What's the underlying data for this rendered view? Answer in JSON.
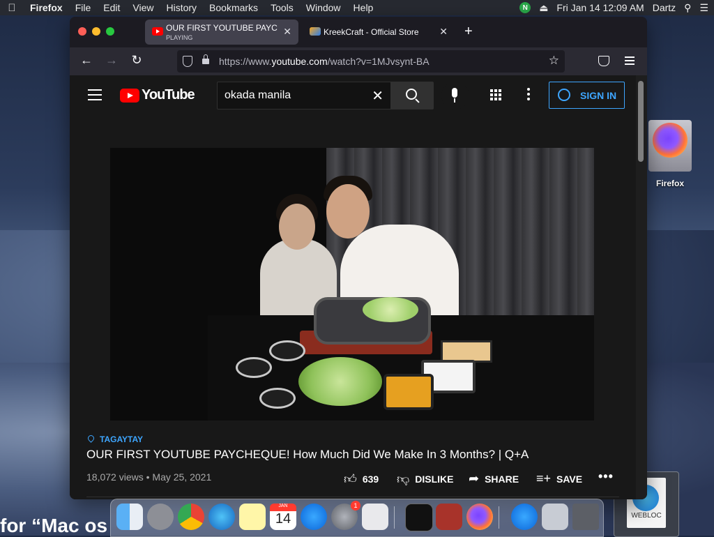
{
  "menubar": {
    "apple": "",
    "items": [
      "Firefox",
      "File",
      "Edit",
      "View",
      "History",
      "Bookmarks",
      "Tools",
      "Window",
      "Help"
    ],
    "clock": "Fri Jan 14  12:09 AM",
    "user": "Dartz",
    "n_badge": "N"
  },
  "browser": {
    "tabs": [
      {
        "title": "OUR FIRST YOUTUBE PAYCHEQUE! How Much Did We Make",
        "subtitle": "PLAYING",
        "active": true
      },
      {
        "title": "KreekCraft - Official Store",
        "subtitle": "",
        "active": false
      }
    ],
    "url_prefix": "https://www.",
    "url_domain": "youtube.com",
    "url_path": "/watch?v=1MJvsynt-BA"
  },
  "youtube": {
    "logo_text": "YouTube",
    "search_query": "okada manila",
    "sign_in_label": "SIGN IN",
    "location_tag": "TAGAYTAY",
    "video_title": "OUR FIRST YOUTUBE PAYCHEQUE! How Much Did We Make In 3 Months? | Q+A",
    "views": "18,072 views",
    "date": "May 25, 2021",
    "meta_separator": "•",
    "like_count": "639",
    "dislike_label": "DISLIKE",
    "share_label": "SHARE",
    "save_label": "SAVE"
  },
  "desktop": {
    "firefox_icon_label": "Firefox",
    "partial_text": "for “Mac os",
    "webloc_label": "WEBLOC"
  },
  "dock": {
    "calendar_month": "JAN",
    "calendar_day": "14",
    "system_prefs_badge": "1"
  },
  "colors": {
    "accent_blue": "#3ea6ff",
    "youtube_red": "#ff0000",
    "page_bg": "#181818"
  }
}
